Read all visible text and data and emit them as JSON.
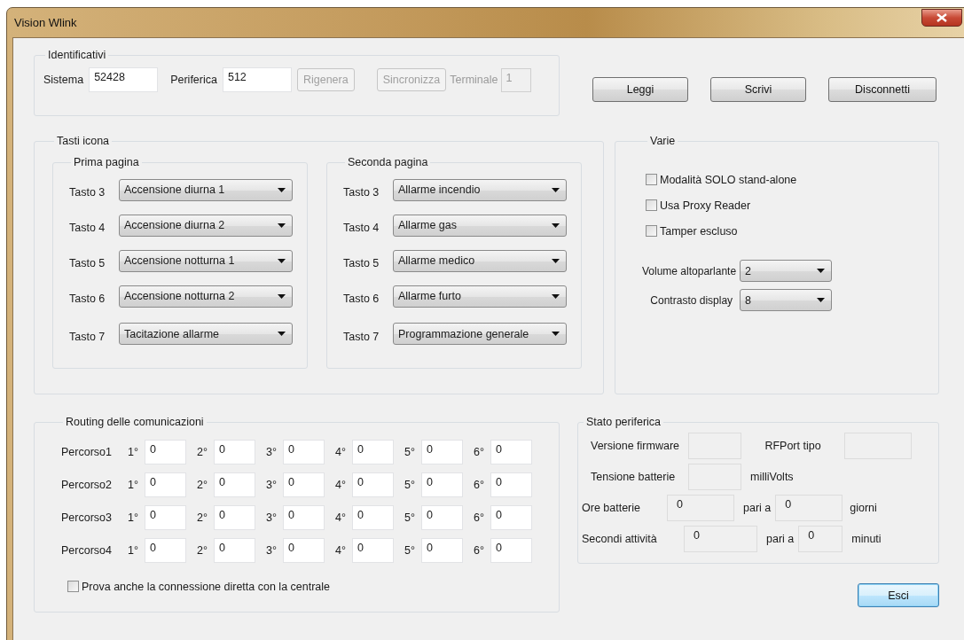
{
  "window": {
    "title": "Vision Wlink"
  },
  "identificativi": {
    "title": "Identificativi",
    "items": [
      {
        "kind": "field",
        "label": "Sistema",
        "value": "52428",
        "disabled": false
      },
      {
        "kind": "field",
        "label": "Periferica",
        "value": "512",
        "disabled": false
      },
      {
        "kind": "button",
        "label": "Rigenera",
        "disabled": true
      },
      {
        "kind": "button",
        "label": "Sincronizza",
        "disabled": true
      },
      {
        "kind": "field",
        "label": "Terminale",
        "value": "1",
        "disabled": true
      }
    ]
  },
  "actions": [
    {
      "label": "Leggi"
    },
    {
      "label": "Scrivi"
    },
    {
      "label": "Disconnetti"
    }
  ],
  "tasti_icona": {
    "title": "Tasti icona",
    "pages": [
      {
        "title": "Prima pagina",
        "keys": [
          {
            "label": "Tasto 3",
            "value": "Accensione diurna 1"
          },
          {
            "label": "Tasto 4",
            "value": "Accensione diurna 2"
          },
          {
            "label": "Tasto 5",
            "value": "Accensione notturna 1"
          },
          {
            "label": "Tasto 6",
            "value": "Accensione notturna 2"
          },
          {
            "label": "Tasto 7",
            "value": "Tacitazione allarme"
          }
        ]
      },
      {
        "title": "Seconda pagina",
        "keys": [
          {
            "label": "Tasto 3",
            "value": "Allarme incendio"
          },
          {
            "label": "Tasto 4",
            "value": "Allarme gas"
          },
          {
            "label": "Tasto 5",
            "value": "Allarme medico"
          },
          {
            "label": "Tasto 6",
            "value": "Allarme furto"
          },
          {
            "label": "Tasto 7",
            "value": "Programmazione generale"
          }
        ]
      }
    ]
  },
  "varie": {
    "title": "Varie",
    "checkboxes": [
      {
        "label": "Modalità SOLO stand-alone",
        "checked": false
      },
      {
        "label": "Usa Proxy Reader",
        "checked": false
      },
      {
        "label": "Tamper escluso",
        "checked": false
      }
    ],
    "selects": [
      {
        "label": "Volume altoparlante",
        "value": "2"
      },
      {
        "label": "Contrasto display",
        "value": "8"
      }
    ]
  },
  "routing": {
    "title": "Routing delle comunicazioni",
    "paths": [
      {
        "label": "Percorso1",
        "hops": [
          {
            "label": "1°",
            "value": "0"
          },
          {
            "label": "2°",
            "value": "0"
          },
          {
            "label": "3°",
            "value": "0"
          },
          {
            "label": "4°",
            "value": "0"
          },
          {
            "label": "5°",
            "value": "0"
          },
          {
            "label": "6°",
            "value": "0"
          }
        ]
      },
      {
        "label": "Percorso2",
        "hops": [
          {
            "label": "1°",
            "value": "0"
          },
          {
            "label": "2°",
            "value": "0"
          },
          {
            "label": "3°",
            "value": "0"
          },
          {
            "label": "4°",
            "value": "0"
          },
          {
            "label": "5°",
            "value": "0"
          },
          {
            "label": "6°",
            "value": "0"
          }
        ]
      },
      {
        "label": "Percorso3",
        "hops": [
          {
            "label": "1°",
            "value": "0"
          },
          {
            "label": "2°",
            "value": "0"
          },
          {
            "label": "3°",
            "value": "0"
          },
          {
            "label": "4°",
            "value": "0"
          },
          {
            "label": "5°",
            "value": "0"
          },
          {
            "label": "6°",
            "value": "0"
          }
        ]
      },
      {
        "label": "Percorso4",
        "hops": [
          {
            "label": "1°",
            "value": "0"
          },
          {
            "label": "2°",
            "value": "0"
          },
          {
            "label": "3°",
            "value": "0"
          },
          {
            "label": "4°",
            "value": "0"
          },
          {
            "label": "5°",
            "value": "0"
          },
          {
            "label": "6°",
            "value": "0"
          }
        ]
      }
    ],
    "checkbox": {
      "label": "Prova anche la connessione diretta con la centrale",
      "checked": false
    }
  },
  "stato_periferica": {
    "title": "Stato periferica",
    "lines": [
      {
        "items": [
          {
            "kind": "label",
            "text": "Versione firmware"
          },
          {
            "kind": "field"
          },
          {
            "kind": "label",
            "text": "RFPort tipo"
          },
          {
            "kind": "field"
          }
        ]
      },
      {
        "items": [
          {
            "kind": "label",
            "text": "Tensione batterie"
          },
          {
            "kind": "field"
          },
          {
            "kind": "label",
            "text": "milliVolts"
          }
        ]
      },
      {
        "items": [
          {
            "kind": "label",
            "text": "Ore batterie"
          },
          {
            "kind": "field",
            "value": "0"
          },
          {
            "kind": "label",
            "text": "pari a"
          },
          {
            "kind": "field",
            "value": "0"
          },
          {
            "kind": "label",
            "text": "giorni"
          }
        ]
      },
      {
        "items": [
          {
            "kind": "label",
            "text": "Secondi attività"
          },
          {
            "kind": "field",
            "value": "0"
          },
          {
            "kind": "label",
            "text": "pari a"
          },
          {
            "kind": "field",
            "value": "0"
          },
          {
            "kind": "label",
            "text": "minuti"
          }
        ]
      }
    ]
  },
  "exit_button": {
    "label": "Esci",
    "focused": true
  }
}
